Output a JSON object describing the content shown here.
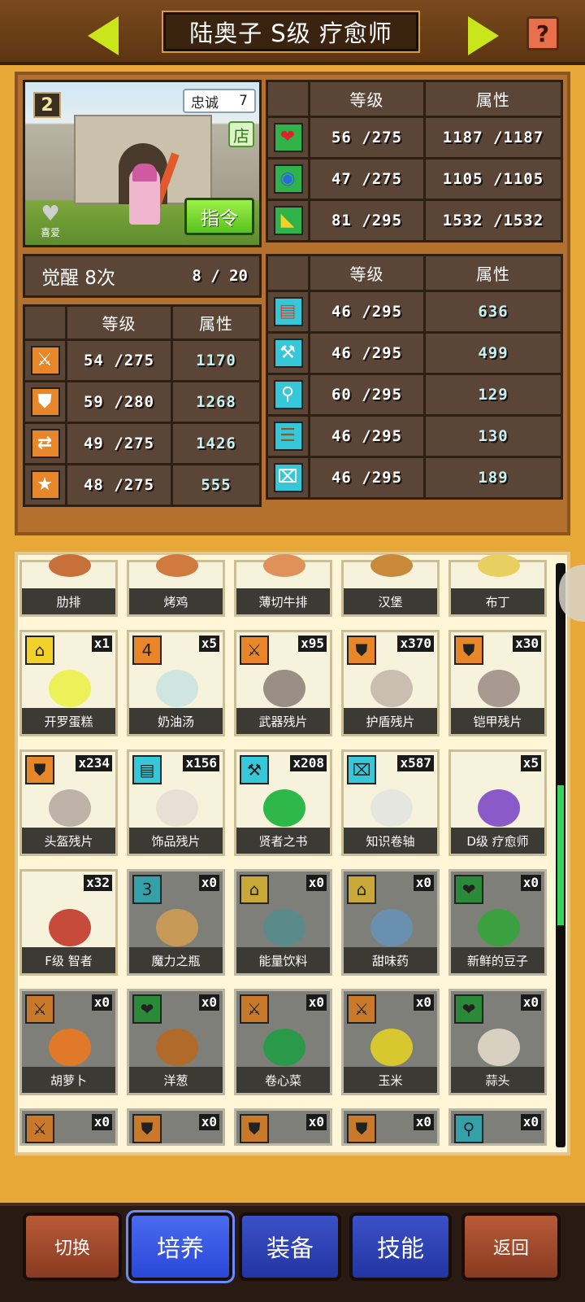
{
  "header": {
    "title": "陆奥子 S级 疗愈师",
    "help_glyph": "?"
  },
  "portrait": {
    "rank": "2",
    "loyalty_label": "忠诚",
    "loyalty_value": "7",
    "shop_badge": "店",
    "command_label": "指令",
    "favorite_label": "喜爱"
  },
  "vitals": {
    "headers": [
      "等级",
      "属性"
    ],
    "rows": [
      {
        "icon": "heart-icon",
        "glyph": "❤",
        "level": "56 /275",
        "value": "1187 /1187"
      },
      {
        "icon": "potion-icon",
        "glyph": "◉",
        "level": "47 /275",
        "value": "1105 /1105"
      },
      {
        "icon": "boot-icon",
        "glyph": "◣",
        "level": "81 /295",
        "value": "1532 /1532"
      }
    ]
  },
  "awaken": {
    "label": "觉醒 8次",
    "progress": "8 /  20"
  },
  "combat_stats": {
    "headers": [
      "等级",
      "属性"
    ],
    "rows": [
      {
        "icon": "sword-icon",
        "glyph": "⚔",
        "level": "54 /275",
        "value": "1170"
      },
      {
        "icon": "shield-icon",
        "glyph": "⛊",
        "level": "59 /280",
        "value": "1268"
      },
      {
        "icon": "arrows-icon",
        "glyph": "⇄",
        "level": "49 /275",
        "value": "1426"
      },
      {
        "icon": "star-icon",
        "glyph": "★",
        "level": "48 /275",
        "value": "555"
      }
    ]
  },
  "craft_stats": {
    "headers": [
      "等级",
      "属性"
    ],
    "rows": [
      {
        "icon": "book-icon",
        "glyph": "▤",
        "level": "46 /295",
        "value": "636"
      },
      {
        "icon": "hammer-icon",
        "glyph": "⚒",
        "level": "46 /295",
        "value": "499"
      },
      {
        "icon": "shovel-icon",
        "glyph": "⚲",
        "level": "60 /295",
        "value": "129"
      },
      {
        "icon": "crate-icon",
        "glyph": "☰",
        "level": "46 /295",
        "value": "130"
      },
      {
        "icon": "scroll-icon",
        "glyph": "⌧",
        "level": "46 /295",
        "value": "189"
      }
    ]
  },
  "items": [
    {
      "label": "肋排",
      "count": "",
      "badge": "",
      "badge_color": "",
      "dim": false,
      "art": "#c8703a"
    },
    {
      "label": "烤鸡",
      "count": "",
      "badge": "",
      "badge_color": "",
      "dim": false,
      "art": "#d07a40"
    },
    {
      "label": "薄切牛排",
      "count": "",
      "badge": "",
      "badge_color": "",
      "dim": false,
      "art": "#e0905a"
    },
    {
      "label": "汉堡",
      "count": "",
      "badge": "",
      "badge_color": "",
      "dim": false,
      "art": "#c88a3a"
    },
    {
      "label": "布丁",
      "count": "",
      "badge": "",
      "badge_color": "",
      "dim": false,
      "art": "#e8d060"
    },
    {
      "label": "开罗蛋糕",
      "count": "x1",
      "badge": "⌂",
      "badge_color": "#f2d22a",
      "dim": false,
      "art": "#eef05a"
    },
    {
      "label": "奶油汤",
      "count": "x5",
      "badge": "4",
      "badge_color": "#e8862a",
      "dim": false,
      "art": "#cfe6e0"
    },
    {
      "label": "武器残片",
      "count": "x95",
      "badge": "⚔",
      "badge_color": "#e8862a",
      "dim": false,
      "art": "#9a8f86"
    },
    {
      "label": "护盾残片",
      "count": "x370",
      "badge": "⛊",
      "badge_color": "#e8862a",
      "dim": false,
      "art": "#c9beb0"
    },
    {
      "label": "铠甲残片",
      "count": "x30",
      "badge": "⛊",
      "badge_color": "#e8862a",
      "dim": false,
      "art": "#a89a90"
    },
    {
      "label": "头盔残片",
      "count": "x234",
      "badge": "⛊",
      "badge_color": "#e8862a",
      "dim": false,
      "art": "#bdb3a8"
    },
    {
      "label": "饰品残片",
      "count": "x156",
      "badge": "▤",
      "badge_color": "#36c8d8",
      "dim": false,
      "art": "#e8e0d4"
    },
    {
      "label": "贤者之书",
      "count": "x208",
      "badge": "⚒",
      "badge_color": "#36c8d8",
      "dim": false,
      "art": "#2fb84a"
    },
    {
      "label": "知识卷轴",
      "count": "x587",
      "badge": "⌧",
      "badge_color": "#36c8d8",
      "dim": false,
      "art": "#e6e6e0"
    },
    {
      "label": "D级 疗愈师",
      "count": "x5",
      "badge": "",
      "badge_color": "",
      "dim": false,
      "art": "#8a5ac8"
    },
    {
      "label": "F级 智者",
      "count": "x32",
      "badge": "",
      "badge_color": "",
      "dim": false,
      "art": "#c84a3a"
    },
    {
      "label": "魔力之瓶",
      "count": "x0",
      "badge": "3",
      "badge_color": "#36a0a8",
      "dim": true,
      "art": "#c89a5a"
    },
    {
      "label": "能量饮料",
      "count": "x0",
      "badge": "⌂",
      "badge_color": "#c8a838",
      "dim": true,
      "art": "#5a8a8a"
    },
    {
      "label": "甜味药",
      "count": "x0",
      "badge": "⌂",
      "badge_color": "#c8a838",
      "dim": true,
      "art": "#6a90b0"
    },
    {
      "label": "新鲜的豆子",
      "count": "x0",
      "badge": "❤",
      "badge_color": "#2a8a3a",
      "dim": true,
      "art": "#3aa040"
    },
    {
      "label": "胡萝卜",
      "count": "x0",
      "badge": "⚔",
      "badge_color": "#c87a2a",
      "dim": true,
      "art": "#e07a2a"
    },
    {
      "label": "洋葱",
      "count": "x0",
      "badge": "❤",
      "badge_color": "#2a8a3a",
      "dim": true,
      "art": "#b06a2a"
    },
    {
      "label": "卷心菜",
      "count": "x0",
      "badge": "⚔",
      "badge_color": "#c87a2a",
      "dim": true,
      "art": "#2a9a4a"
    },
    {
      "label": "玉米",
      "count": "x0",
      "badge": "⚔",
      "badge_color": "#c87a2a",
      "dim": true,
      "art": "#d8c830"
    },
    {
      "label": "蒜头",
      "count": "x0",
      "badge": "❤",
      "badge_color": "#2a8a3a",
      "dim": true,
      "art": "#d8d0c0"
    },
    {
      "label": "",
      "count": "x0",
      "badge": "⚔",
      "badge_color": "#c87a2a",
      "dim": true,
      "art": ""
    },
    {
      "label": "",
      "count": "x0",
      "badge": "⛊",
      "badge_color": "#c87a2a",
      "dim": true,
      "art": ""
    },
    {
      "label": "",
      "count": "x0",
      "badge": "⛊",
      "badge_color": "#c87a2a",
      "dim": true,
      "art": ""
    },
    {
      "label": "",
      "count": "x0",
      "badge": "⛊",
      "badge_color": "#c87a2a",
      "dim": true,
      "art": ""
    },
    {
      "label": "",
      "count": "x0",
      "badge": "⚲",
      "badge_color": "#36a0a8",
      "dim": true,
      "art": ""
    }
  ],
  "nav": {
    "switch": "切换",
    "train": "培养",
    "equip": "装备",
    "skill": "技能",
    "back": "返回"
  }
}
